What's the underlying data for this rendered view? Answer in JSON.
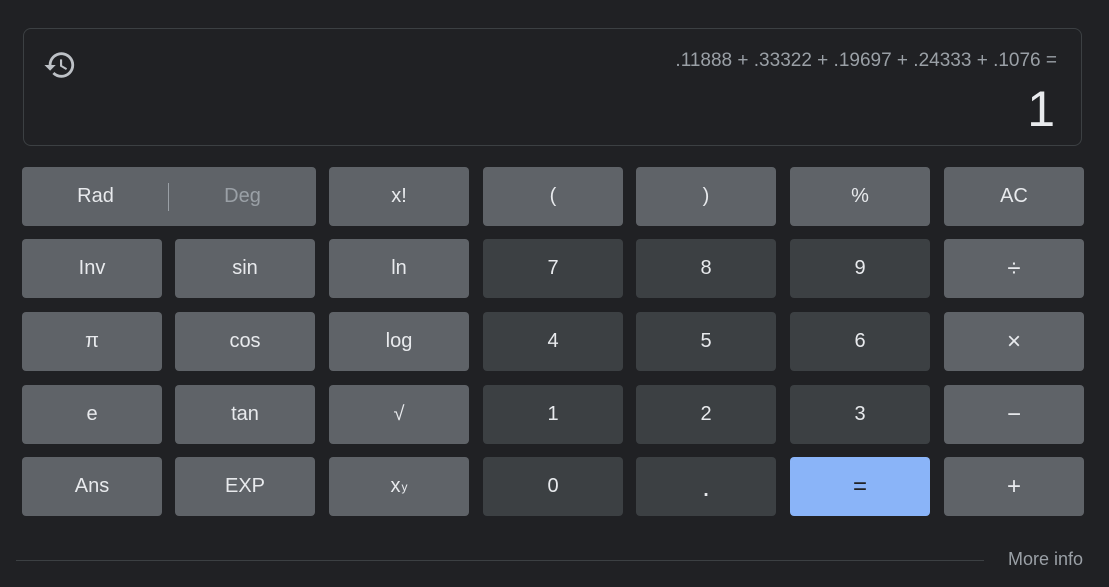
{
  "display": {
    "history_icon": "history-icon",
    "expression": ".11888 + .33322 + .19697 + .24333 + .1076 =",
    "result": "1"
  },
  "keys": {
    "rad": "Rad",
    "deg": "Deg",
    "factorial": "x!",
    "open_paren": "(",
    "close_paren": ")",
    "percent": "%",
    "all_clear": "AC",
    "inv": "Inv",
    "sin": "sin",
    "ln": "ln",
    "seven": "7",
    "eight": "8",
    "nine": "9",
    "divide": "÷",
    "pi": "π",
    "cos": "cos",
    "log": "log",
    "four": "4",
    "five": "5",
    "six": "6",
    "multiply": "×",
    "e": "e",
    "tan": "tan",
    "sqrt": "√",
    "one": "1",
    "two": "2",
    "three": "3",
    "minus": "−",
    "ans": "Ans",
    "exp": "EXP",
    "power_base": "x",
    "power_exp": "y",
    "zero": "0",
    "decimal": ".",
    "equals": "=",
    "plus": "+"
  },
  "footer": {
    "more_info": "More info"
  },
  "colors": {
    "background": "#202124",
    "function_key": "#5f6368",
    "number_key": "#3c4043",
    "equals_key": "#8ab4f8",
    "text": "#e8eaed",
    "muted_text": "#9aa0a6"
  }
}
